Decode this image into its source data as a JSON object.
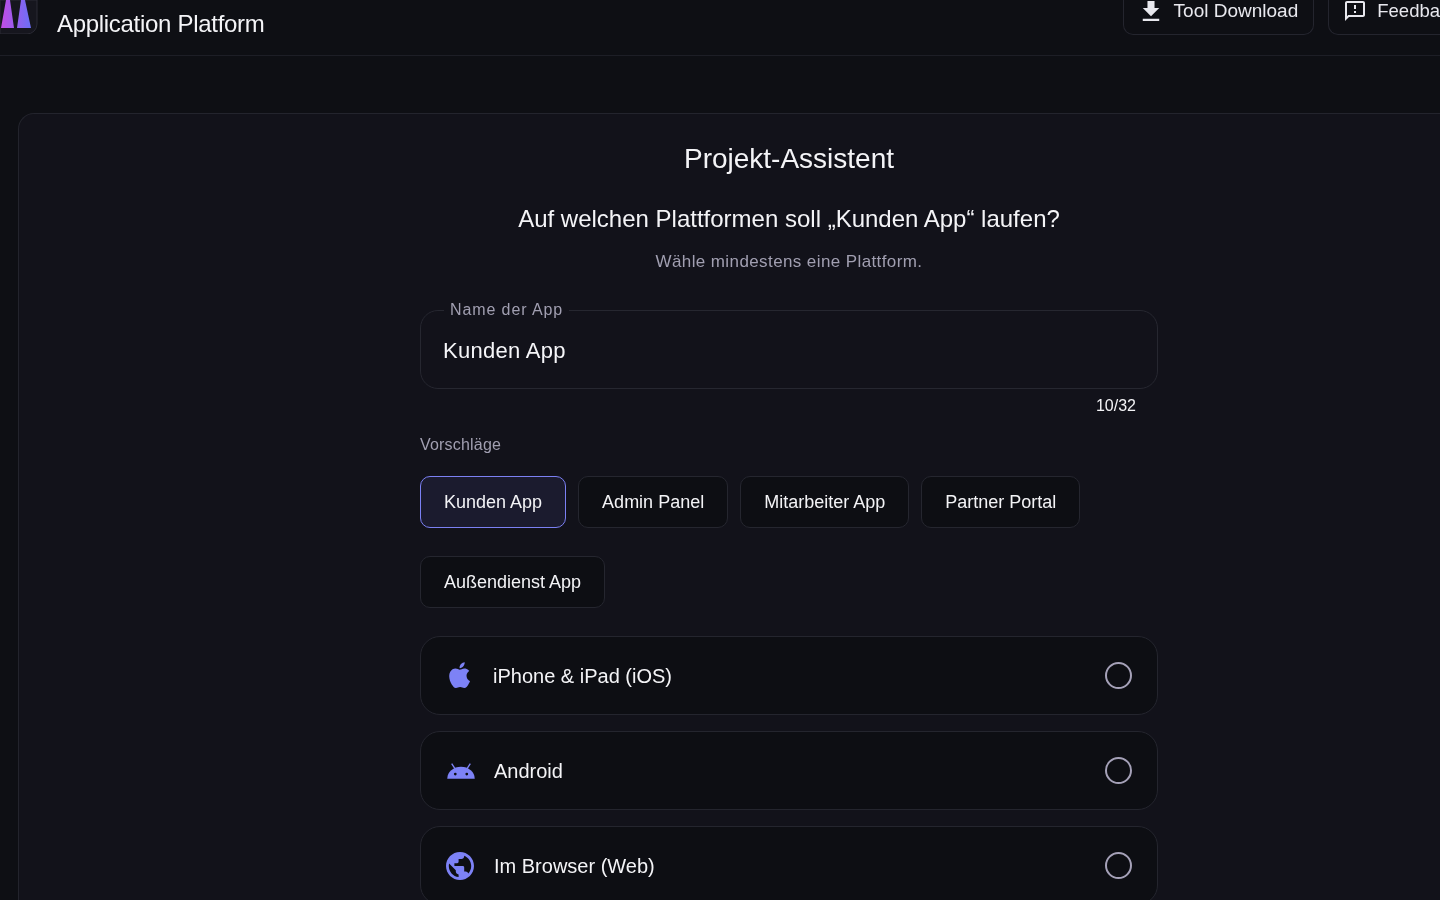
{
  "header": {
    "title": "Application Platform",
    "buttons": [
      {
        "kind": "download",
        "label": "Tool Download"
      },
      {
        "kind": "feedback",
        "label": "Feedba"
      }
    ]
  },
  "wizard": {
    "title": "Projekt-Assistent",
    "question": "Auf welchen Plattformen soll „Kunden App“ laufen?",
    "hint": "Wähle mindestens eine Plattform.",
    "name_field": {
      "label": "Name der App",
      "value": "Kunden App",
      "counter": "10/32"
    },
    "suggestions": {
      "label": "Vorschläge",
      "items": [
        {
          "label": "Kunden App",
          "selected": true
        },
        {
          "label": "Admin Panel",
          "selected": false
        },
        {
          "label": "Mitarbeiter App",
          "selected": false
        },
        {
          "label": "Partner Portal",
          "selected": false
        },
        {
          "label": "Außendienst App",
          "selected": false
        }
      ]
    },
    "platforms": [
      {
        "kind": "ios",
        "label": "iPhone & iPad (iOS)",
        "selected": false
      },
      {
        "kind": "android",
        "label": "Android",
        "selected": false
      },
      {
        "kind": "web",
        "label": "Im Browser (Web)",
        "selected": false
      }
    ]
  }
}
